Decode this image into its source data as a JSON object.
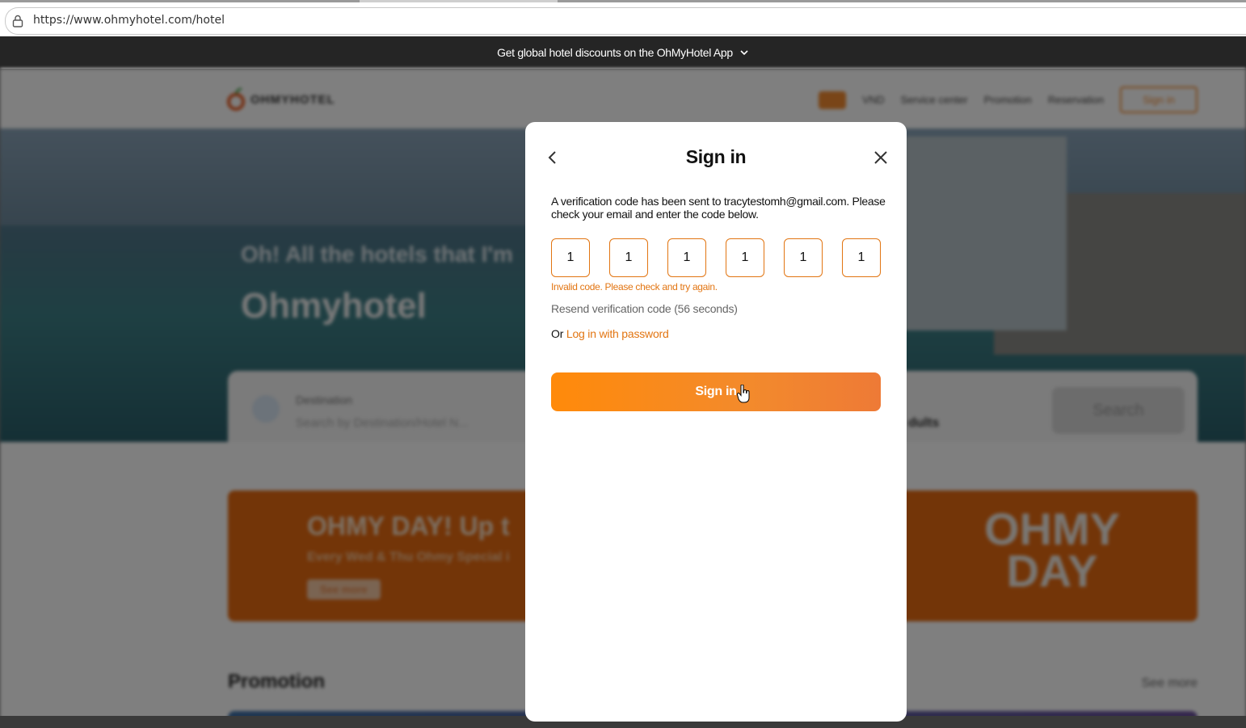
{
  "browser": {
    "url": "https://www.ohmyhotel.com/hotel"
  },
  "app_banner": {
    "text": "Get global hotel discounts on the OhMyHotel App"
  },
  "header": {
    "logo_text": "OHMYHOTEL",
    "currency": "VND",
    "nav": [
      "Service center",
      "Promotion",
      "Reservation"
    ],
    "sign_in": "Sign in"
  },
  "hero": {
    "tagline": "Oh! All the hotels that I'm",
    "brand": "Ohmyhotel",
    "search": {
      "destination_label": "Destination",
      "destination_placeholder": "Search by Destination/Hotel N...",
      "guests_label": "s",
      "guests_value": "dults",
      "search_button": "Search"
    }
  },
  "promo": {
    "headline": "OHMY DAY! Up t",
    "subline": "Every Wed & Thu Ohmy Special i",
    "see_more_btn": "See more",
    "logo_line1": "OHMY",
    "logo_line2": "DAY",
    "section_title": "Promotion",
    "section_see_more": "See more"
  },
  "modal": {
    "title": "Sign in",
    "message": "A verification code has been sent to tracytestomh@gmail.com. Please check your email and enter the code below.",
    "code_digits": [
      "1",
      "1",
      "1",
      "1",
      "1",
      "1"
    ],
    "error": "Invalid code. Please check and try again.",
    "resend": "Resend verification code (56 seconds)",
    "alt_prefix": "Or",
    "alt_link": "Log in with password",
    "submit": "Sign in"
  },
  "colors": {
    "accent": "#e27512",
    "button_start": "#ff8a0a",
    "button_end": "#ee7a36",
    "banner_bg": "#252525"
  },
  "icons": {
    "lock": "lock-icon",
    "chevron": "chevron-down-icon",
    "back": "chevron-left-icon",
    "close": "close-icon",
    "cursor": "hand-cursor-icon"
  }
}
